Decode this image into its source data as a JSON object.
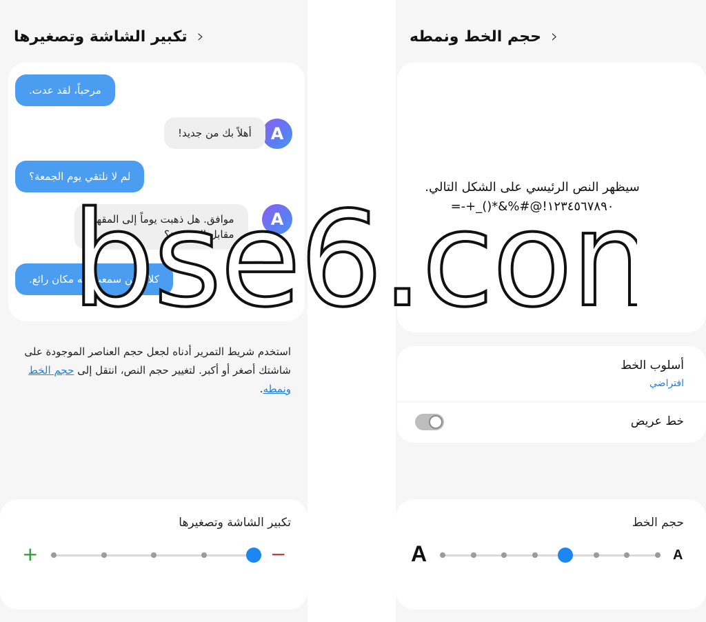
{
  "left": {
    "header": {
      "title": "تكبير الشاشة وتصغيرها",
      "back_glyph": "‹"
    },
    "chat": [
      {
        "side": "me",
        "text": "مرحباً، لقد عدت."
      },
      {
        "side": "them",
        "text": "أهلاً بك من جديد!",
        "avatar": "A"
      },
      {
        "side": "me",
        "text": "لم لا نلتقي يوم الجمعة؟"
      },
      {
        "side": "them",
        "line1": "موافق. هل ذهبت يوماً إلى المقهى",
        "line2": "مقابل المدرسة؟",
        "avatar": "A"
      },
      {
        "side": "me",
        "text": "كلا، لكن سمعت أنه مكان رائع."
      }
    ],
    "description": {
      "text": "استخدم شريط التمرير أدناه لجعل حجم العناصر الموجودة على شاشتك أصغر أو أكبر. لتغيير حجم النص، انتقل إلى ",
      "link": "حجم الخط ونمطه",
      "end": "."
    },
    "zoom": {
      "label": "تكبير الشاشة وتصغيرها",
      "plus": "+",
      "minus": "−",
      "steps": 5,
      "selected_step_from_left": 5
    }
  },
  "right": {
    "header": {
      "title": "حجم الخط ونمطه",
      "back_glyph": "‹"
    },
    "preview": {
      "line1": "سيظهر النص الرئيسي على الشكل التالي.",
      "line2": "١٢٣٤٥٦٧٨٩٠!@#%&*()_+-="
    },
    "font_style": {
      "title": "أسلوب الخط",
      "value": "افتراضي"
    },
    "bold_font": {
      "title": "خط عريض",
      "enabled": false
    },
    "font_size": {
      "label": "حجم الخط",
      "large_a": "A",
      "small_a": "A",
      "steps": 8,
      "selected_step_from_left": 5
    }
  },
  "watermark": "bse6.com",
  "colors": {
    "accent": "#1c87f2",
    "bubble_me": "#4a9df0",
    "bubble_them": "#efefef",
    "background": "#f6f6f6",
    "plus": "#2e9a3c",
    "minus": "#d23c3c"
  }
}
